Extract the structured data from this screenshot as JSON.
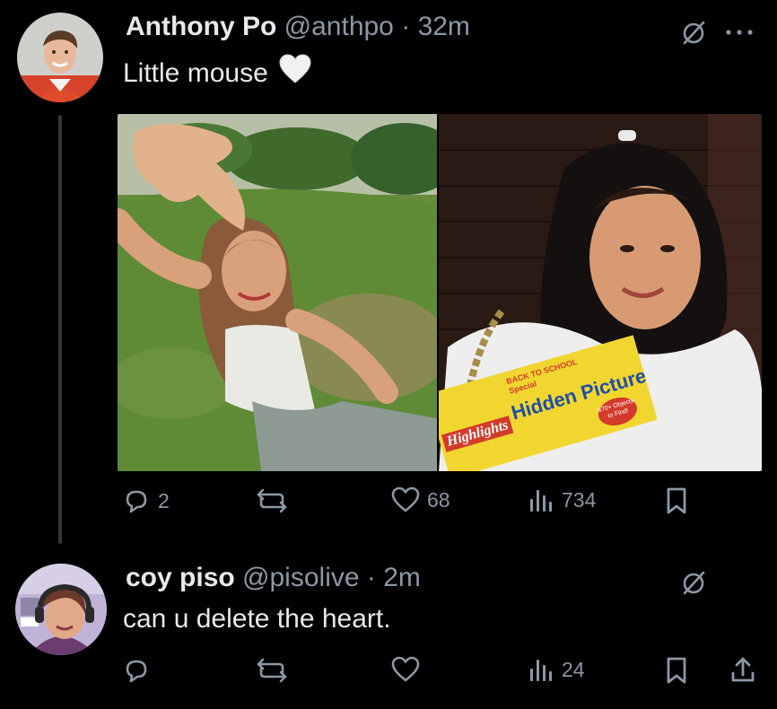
{
  "tweet1": {
    "display_name": "Anthony Po",
    "handle": "@anthpo",
    "separator": "·",
    "time": "32m",
    "text": "Little mouse",
    "emoji": "white-heart",
    "metrics": {
      "replies": "2",
      "reposts": "",
      "likes": "68",
      "views": "734"
    },
    "media": {
      "left": {
        "magazine_brand": "Highlights",
        "magazine_banner": "BACK TO SCHOOL Special",
        "magazine_title": "Hidden Pictures",
        "magazine_badge": "870+ Objects to Find!"
      }
    }
  },
  "tweet2": {
    "display_name": "coy piso",
    "handle": "@pisolive",
    "separator": "·",
    "time": "2m",
    "text": "can u delete the heart.",
    "metrics": {
      "replies": "",
      "reposts": "",
      "likes": "",
      "views": "24"
    }
  },
  "icons": {
    "grok": "grok-icon",
    "more": "more-icon",
    "reply": "reply-icon",
    "repost": "repost-icon",
    "like": "heart-icon",
    "views": "views-icon",
    "bookmark": "bookmark-icon",
    "share": "share-icon"
  },
  "colors": {
    "background": "#000000",
    "text": "#e7e9ea",
    "muted": "#8b98a5",
    "thread_line": "#333639"
  }
}
